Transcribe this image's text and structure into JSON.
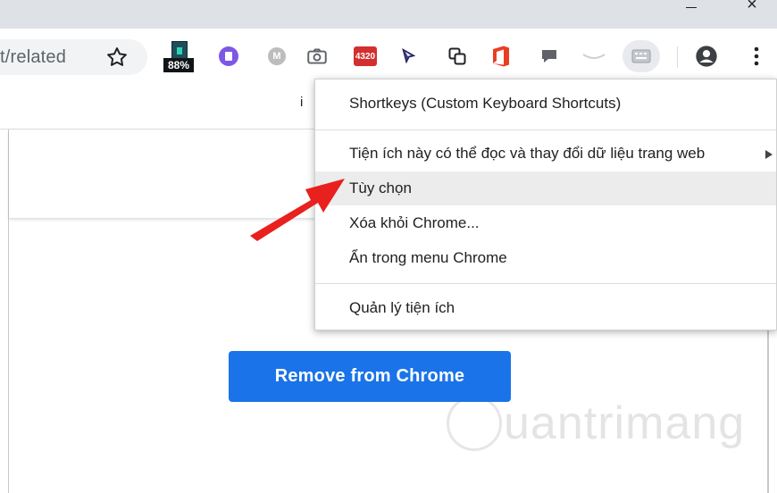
{
  "omnibox": {
    "url_fragment": "t/related"
  },
  "toolbar": {
    "battery_badge": "88%",
    "badge_4320": "4320",
    "grey_ext_letter": "M"
  },
  "peek_text": "i",
  "context_menu": {
    "items": [
      {
        "label": "Shortkeys (Custom Keyboard Shortcuts)"
      },
      {
        "label": "Tiện ích này có thể đọc và thay đổi dữ liệu trang web"
      },
      {
        "label": "Tùy chọn"
      },
      {
        "label": "Xóa khỏi Chrome..."
      },
      {
        "label": "Ẩn trong menu Chrome"
      },
      {
        "label": "Quản lý tiện ích"
      }
    ]
  },
  "page": {
    "remove_button_label": "Remove from Chrome",
    "watermark_text": "uantrimang"
  },
  "colors": {
    "primary_button": "#1a73e8",
    "highlight_row": "#ececec",
    "annotation_arrow": "#e8201e"
  },
  "icons": [
    "star-icon",
    "battery-icon",
    "camera-icon",
    "cursor-icon",
    "copy-icon",
    "office-icon",
    "comment-icon",
    "keyboard-icon",
    "profile-icon",
    "more-vert-icon"
  ]
}
